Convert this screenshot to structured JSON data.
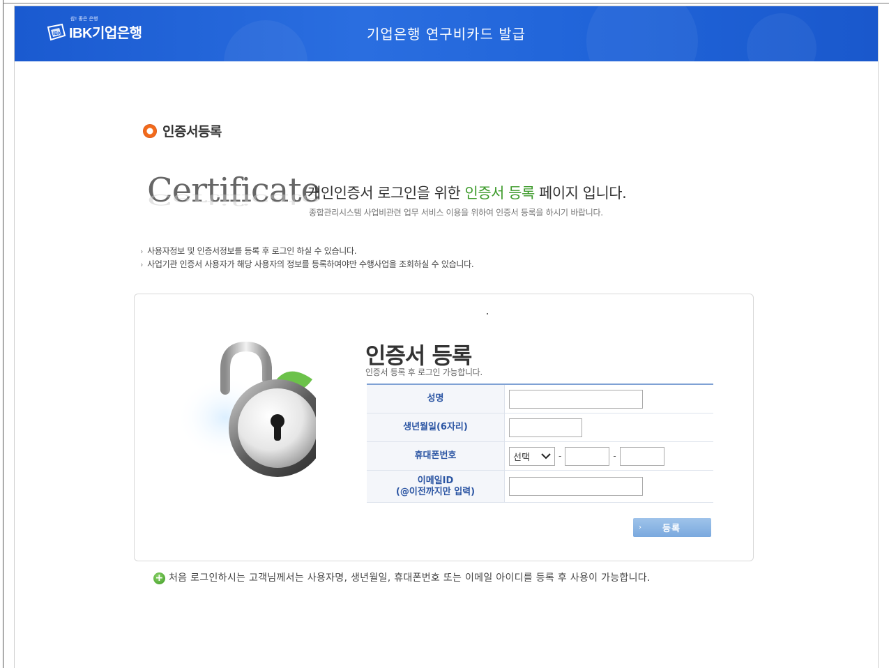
{
  "header": {
    "logo_slogan": "참! 좋은 은행",
    "logo_text": "IBK기업은행",
    "title": "기업은행 연구비카드 발급"
  },
  "section": {
    "title": "인증서등록"
  },
  "intro": {
    "cert_word": "Certificate",
    "heading_before": "개인인증서 로그인을 위한 ",
    "heading_highlight": "인증서 등록",
    "heading_after": " 페이지 입니다.",
    "subtext": "종합관리시스템 사업비관련 업무 서비스 이용을 위하여 인증서 등록을 하시기 바랍니다."
  },
  "notes": [
    "사용자정보 및 인증서정보를 등록 후 로그인 하실 수 있습니다.",
    "사업기관 인증서 사용자가 해당 사용자의 정보를 등록하여야만 수행사업을 조회하실 수 있습니다."
  ],
  "form": {
    "title": "인증서 등록",
    "subtitle": "인증서 등록 후 로그인 가능합니다.",
    "labels": {
      "name": "성명",
      "birth": "생년월일(6자리)",
      "phone": "휴대폰번호",
      "email_line1": "이메일ID",
      "email_line2": "(@이전까지만 입력)"
    },
    "values": {
      "name": "",
      "birth": "",
      "phone_prefix": "선택",
      "phone_mid": "",
      "phone_last": "",
      "email": ""
    },
    "phone_separator": "-",
    "submit_label": "등록"
  },
  "footer": {
    "note": "처음 로그인하시는 고객님께서는 사용자명, 생년월일, 휴대폰번호 또는 이메일 아이디를 등록 후 사용이 가능합니다."
  },
  "colors": {
    "header_blue": "#1f63d8",
    "highlight_green": "#3e9b2c",
    "label_blue": "#2b55a3",
    "button_blue": "#7aa9de",
    "section_orange": "#f26a1b"
  }
}
